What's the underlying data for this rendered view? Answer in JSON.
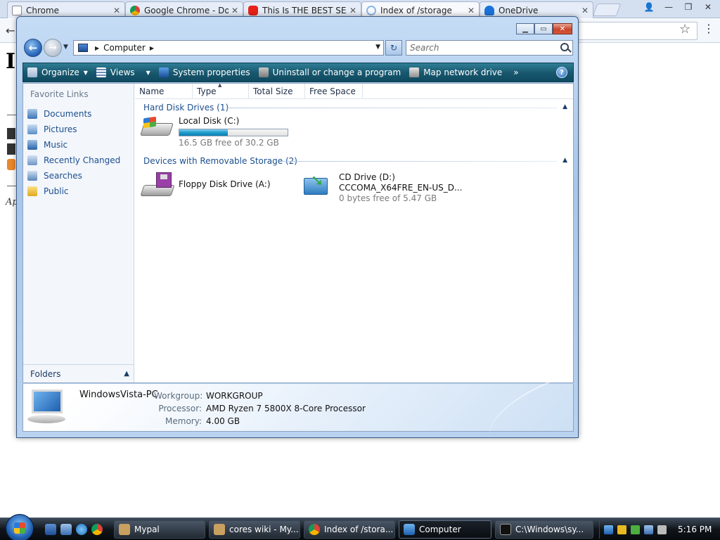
{
  "browser": {
    "tabs": [
      {
        "title": "Chrome",
        "icon": "page-icon"
      },
      {
        "title": "Google Chrome - Do",
        "icon": "chrome-icon"
      },
      {
        "title": "This Is THE BEST SEA",
        "icon": "youtube-icon"
      },
      {
        "title": "Index of /storage",
        "icon": "loading-icon"
      },
      {
        "title": "OneDrive",
        "icon": "onedrive-icon"
      }
    ],
    "page_heading_fragment": "I",
    "page_italic_fragment": "Ap"
  },
  "explorer": {
    "address": {
      "crumb": "Computer"
    },
    "search": {
      "placeholder": "Search"
    },
    "commands": {
      "organize": "Organize",
      "views": "Views",
      "system_properties": "System properties",
      "uninstall": "Uninstall or change a program",
      "map_drive": "Map network drive",
      "more": "»",
      "help": "?"
    },
    "favorites": {
      "title": "Favorite Links",
      "items": [
        "Documents",
        "Pictures",
        "Music",
        "Recently Changed",
        "Searches",
        "Public"
      ]
    },
    "folders_label": "Folders",
    "columns": [
      "Name",
      "Type",
      "Total Size",
      "Free Space"
    ],
    "groups": {
      "hdd": "Hard Disk Drives (1)",
      "removable": "Devices with Removable Storage (2)"
    },
    "drives": {
      "c": {
        "name": "Local Disk (C:)",
        "free": "16.5 GB free of 30.2 GB",
        "used_fraction": 0.45
      },
      "a": {
        "name": "Floppy Disk Drive (A:)"
      },
      "d": {
        "name": "CD Drive (D:)",
        "label": "CCCOMA_X64FRE_EN-US_D...",
        "free": "0 bytes free of 5.47 GB"
      }
    },
    "details": {
      "pc_name": "WindowsVista-PC",
      "workgroup_label": "Workgroup:",
      "workgroup": "WORKGROUP",
      "processor_label": "Processor:",
      "processor": "AMD Ryzen 7 5800X 8-Core Processor",
      "memory_label": "Memory:",
      "memory": "4.00 GB"
    }
  },
  "taskbar": {
    "tasks": [
      "Mypal",
      "cores wiki - My...",
      "Index of /stora...",
      "Computer",
      "C:\\Windows\\sy..."
    ],
    "clock": "5:16 PM"
  },
  "colors": {
    "accent": "#1b4f8f",
    "cmdbar": "#17566d",
    "usage_fill": "#1d9bcb"
  }
}
